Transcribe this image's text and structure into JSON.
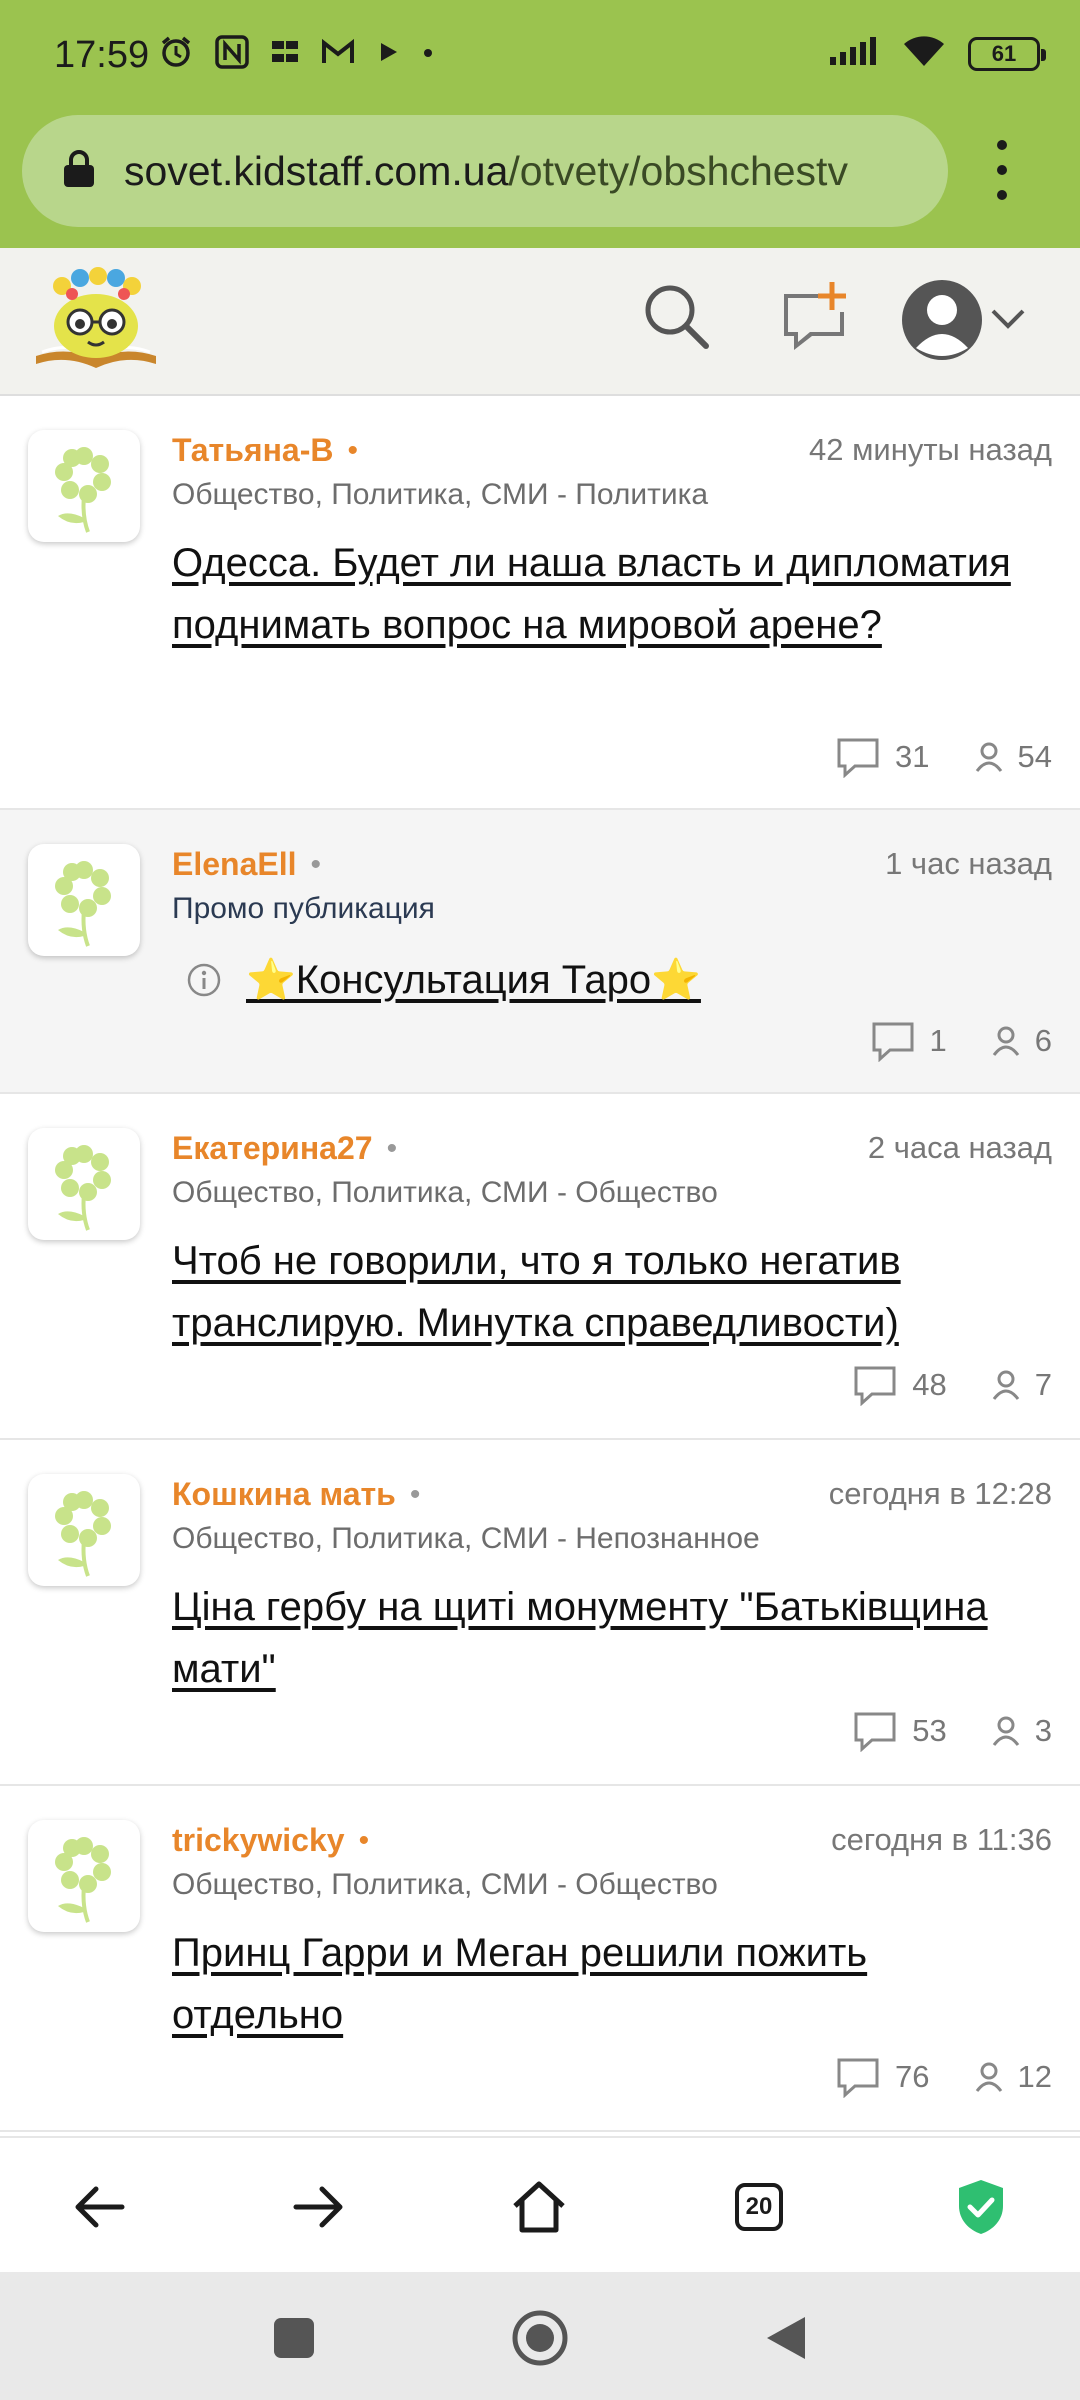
{
  "status_bar": {
    "time": "17:59",
    "battery": "61"
  },
  "browser": {
    "url_domain": "sovet.kidstaff.com.ua",
    "url_path": "/otvety/obshchestv",
    "tabs_count": "20"
  },
  "colors": {
    "accent_green": "#9bc34f",
    "author_orange": "#e8862a",
    "shield_green": "#2fbf71"
  },
  "posts": [
    {
      "author": "Татьяна-В",
      "time": "42 минуты назад",
      "category": "Общество, Политика, СМИ - Политика",
      "title": "Одесса. Будет ли наша власть и дипломатия поднимать вопрос на мировой арене?",
      "comments": "31",
      "views": "54"
    },
    {
      "author": "ElenaEll",
      "time": "1 час назад",
      "category": "Промо публикация",
      "title": "⭐Консультация Таро⭐",
      "comments": "1",
      "views": "6"
    },
    {
      "author": "Екатерина27",
      "time": "2 часа назад",
      "category": "Общество, Политика, СМИ - Общество",
      "title": "Чтоб не говорили, что я только негатив транслирую. Минутка справедливости)",
      "comments": "48",
      "views": "7"
    },
    {
      "author": "Кошкина мать",
      "time": "сегодня в 12:28",
      "category": "Общество, Политика, СМИ - Непознанное",
      "title": "Ціна гербу на щиті монументу \"Батьківщина мати\"",
      "comments": "53",
      "views": "3"
    },
    {
      "author": "trickywicky",
      "time": "сегодня в 11:36",
      "category": "Общество, Политика, СМИ - Общество",
      "title": "Принц Гарри и Меган решили пожить отдельно",
      "comments": "76",
      "views": "12"
    }
  ]
}
